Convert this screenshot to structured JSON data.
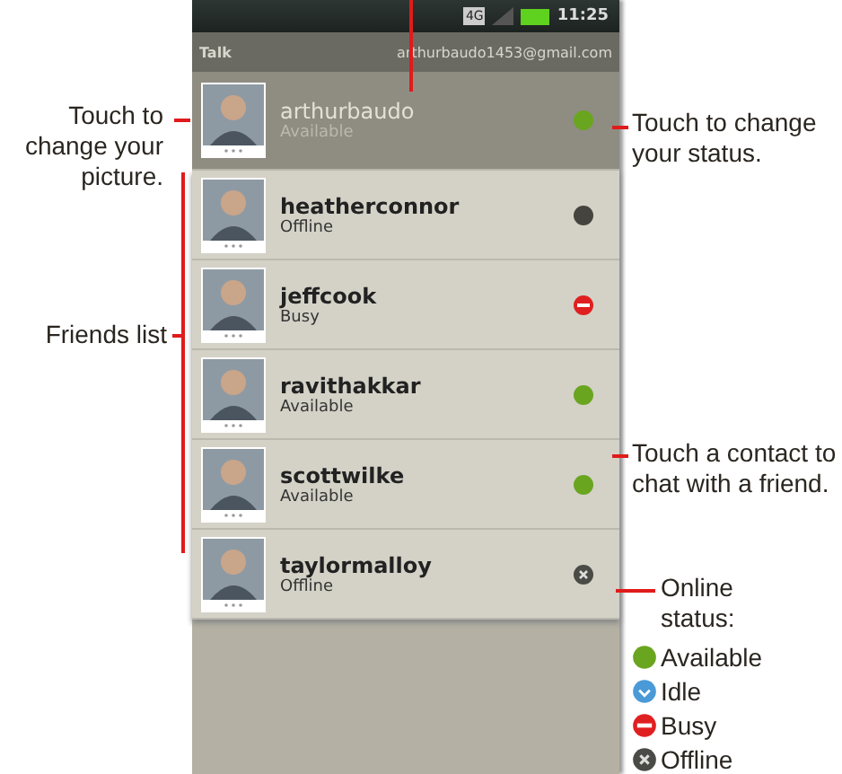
{
  "status_bar": {
    "network": "4G",
    "time": "11:25"
  },
  "app_bar": {
    "title": "Talk",
    "account": "arthurbaudo1453@gmail.com"
  },
  "me": {
    "name": "arthurbaudo",
    "status_text": "Available",
    "kind": "available"
  },
  "friends": [
    {
      "name": "heatherconnor",
      "status_text": "Offline",
      "kind": "dark"
    },
    {
      "name": "jeffcook",
      "status_text": "Busy",
      "kind": "busy"
    },
    {
      "name": "ravithakkar",
      "status_text": "Available",
      "kind": "available"
    },
    {
      "name": "scottwilke",
      "status_text": "Available",
      "kind": "available"
    },
    {
      "name": "taylormalloy",
      "status_text": "Offline",
      "kind": "offline"
    }
  ],
  "callouts": [
    {
      "kind": "picture",
      "text": "Touch to change your picture."
    },
    {
      "kind": "list",
      "text": "Friends list"
    },
    {
      "kind": "status",
      "text": "Touch to change your status."
    },
    {
      "kind": "chat",
      "text": "Touch a contact to chat with a friend."
    },
    {
      "kind": "legend",
      "text": "Online status:"
    }
  ],
  "legend": [
    {
      "kind": "available",
      "label": "Available"
    },
    {
      "kind": "idle",
      "label": "Idle"
    },
    {
      "kind": "busy",
      "label": "Busy"
    },
    {
      "kind": "offline",
      "label": "Offline"
    }
  ]
}
